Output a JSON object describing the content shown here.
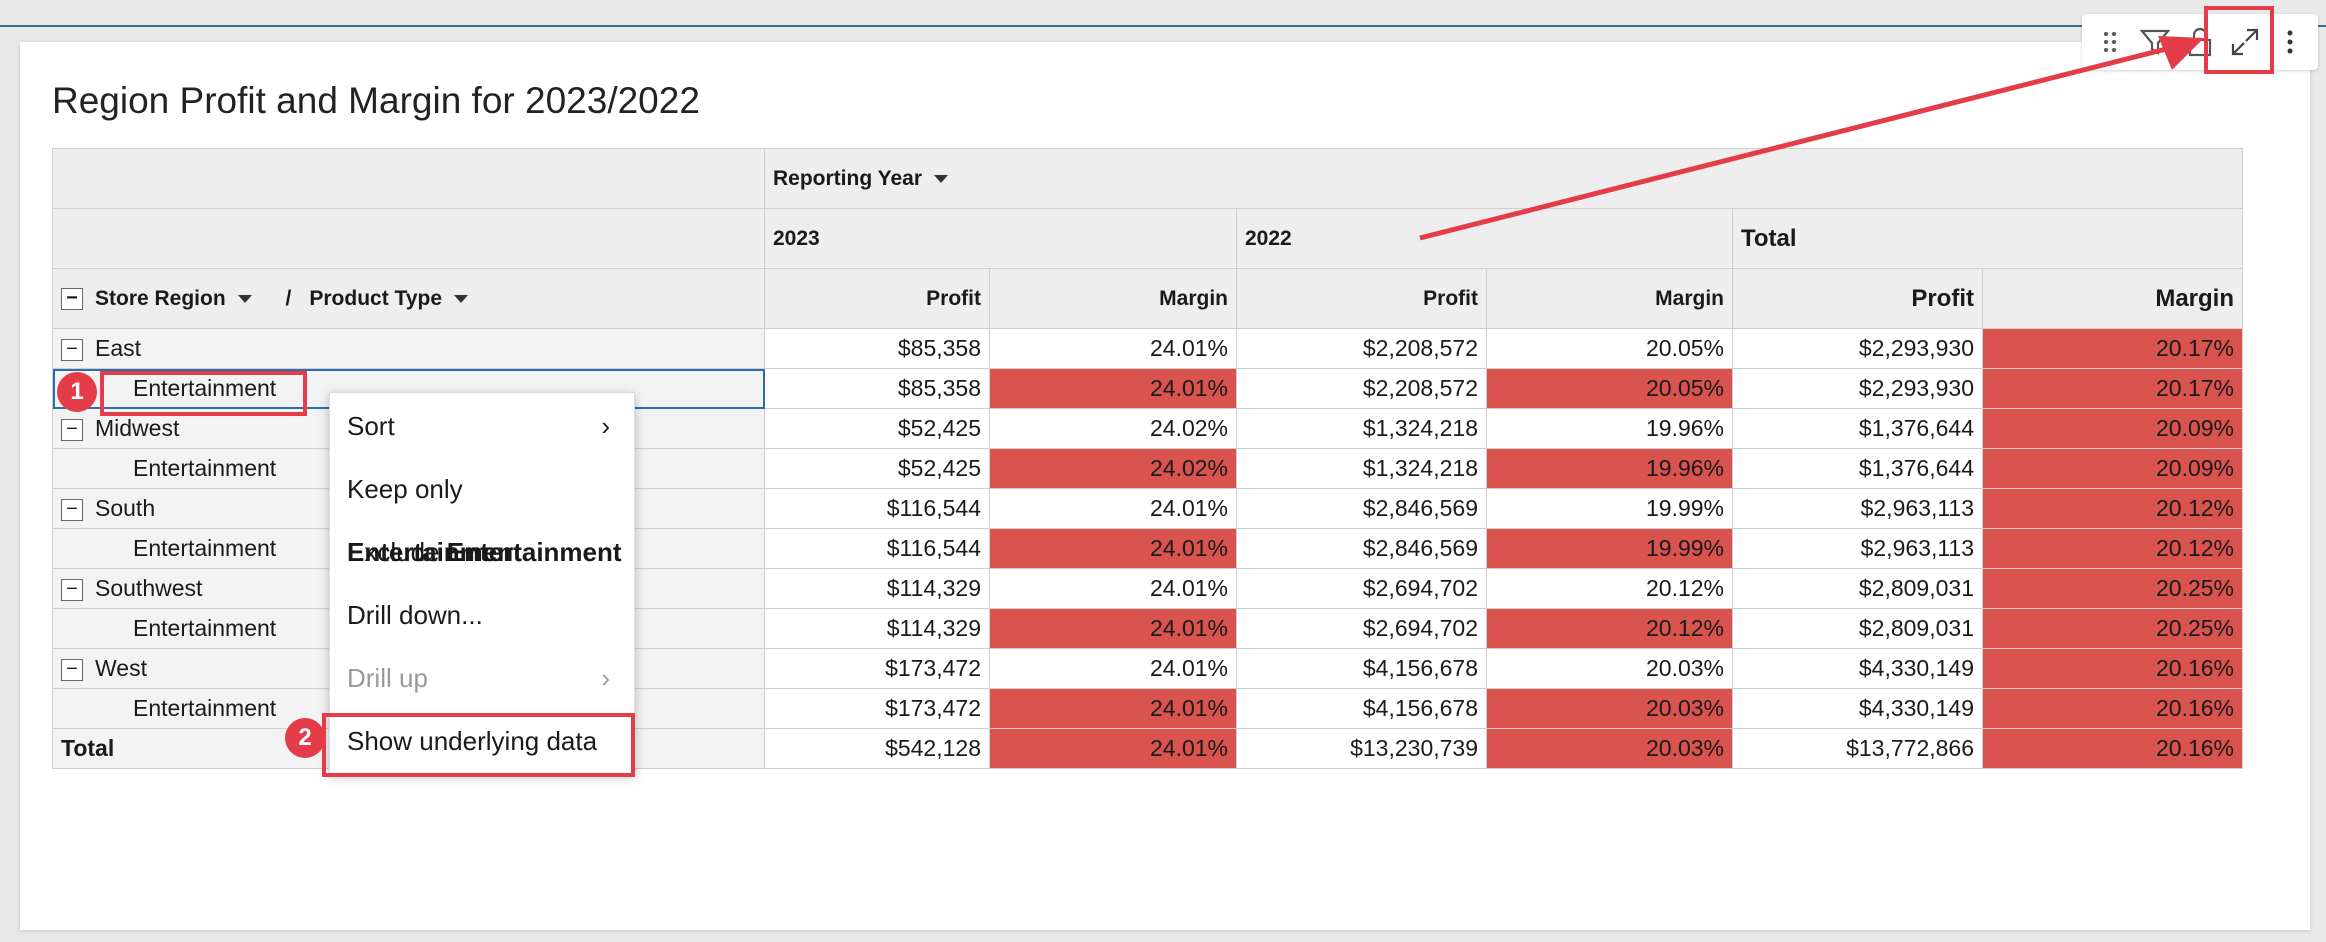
{
  "title": "Region Profit and Margin for 2023/2022",
  "colors": {
    "highlight": "#d9534f",
    "annotation_red": "#e53c49",
    "accent_line": "#3d6f86"
  },
  "toolbar": {
    "icons": [
      "drag-handle-icon",
      "filter-icon",
      "lock-icon",
      "expand-icon",
      "more-vertical-icon"
    ]
  },
  "pivot": {
    "column_field": "Reporting Year",
    "row_fields": [
      "Store Region",
      "Product Type"
    ],
    "separator": "/",
    "year_headers": [
      "2023",
      "2022",
      "Total"
    ],
    "measure_headers": [
      "Profit",
      "Margin",
      "Profit",
      "Margin",
      "Profit",
      "Margin"
    ],
    "rows": [
      {
        "label": "East",
        "level": 0,
        "values": [
          "$85,358",
          "24.01%",
          "$2,208,572",
          "20.05%",
          "$2,293,930",
          "20.17%"
        ]
      },
      {
        "label": "Entertainment",
        "level": 1,
        "values": [
          "$85,358",
          "24.01%",
          "$2,208,572",
          "20.05%",
          "$2,293,930",
          "20.17%"
        ]
      },
      {
        "label": "Midwest",
        "level": 0,
        "values": [
          "$52,425",
          "24.02%",
          "$1,324,218",
          "19.96%",
          "$1,376,644",
          "20.09%"
        ]
      },
      {
        "label": "Entertainment",
        "level": 1,
        "values": [
          "$52,425",
          "24.02%",
          "$1,324,218",
          "19.96%",
          "$1,376,644",
          "20.09%"
        ]
      },
      {
        "label": "South",
        "level": 0,
        "values": [
          "$116,544",
          "24.01%",
          "$2,846,569",
          "19.99%",
          "$2,963,113",
          "20.12%"
        ]
      },
      {
        "label": "Entertainment",
        "level": 1,
        "values": [
          "$116,544",
          "24.01%",
          "$2,846,569",
          "19.99%",
          "$2,963,113",
          "20.12%"
        ]
      },
      {
        "label": "Southwest",
        "level": 0,
        "values": [
          "$114,329",
          "24.01%",
          "$2,694,702",
          "20.12%",
          "$2,809,031",
          "20.25%"
        ]
      },
      {
        "label": "Entertainment",
        "level": 1,
        "values": [
          "$114,329",
          "24.01%",
          "$2,694,702",
          "20.12%",
          "$2,809,031",
          "20.25%"
        ]
      },
      {
        "label": "West",
        "level": 0,
        "values": [
          "$173,472",
          "24.01%",
          "$4,156,678",
          "20.03%",
          "$4,330,149",
          "20.16%"
        ]
      },
      {
        "label": "Entertainment",
        "level": 1,
        "values": [
          "$173,472",
          "24.01%",
          "$4,156,678",
          "20.03%",
          "$4,330,149",
          "20.16%"
        ]
      },
      {
        "label": "Total",
        "level": -1,
        "values": [
          "$542,128",
          "24.01%",
          "$13,230,739",
          "20.03%",
          "$13,772,866",
          "20.16%"
        ]
      }
    ]
  },
  "context_menu": {
    "items": [
      {
        "label": "Sort",
        "bold": "",
        "has_submenu": true,
        "disabled": false
      },
      {
        "label": "Keep only ",
        "bold": "Entertainment",
        "has_submenu": false,
        "disabled": false
      },
      {
        "label": "Exclude ",
        "bold": "Entertainment",
        "has_submenu": false,
        "disabled": false
      },
      {
        "label": "Drill down...",
        "bold": "",
        "has_submenu": false,
        "disabled": false
      },
      {
        "label": "Drill up",
        "bold": "",
        "has_submenu": true,
        "disabled": true
      },
      {
        "label": "Show underlying data",
        "bold": "",
        "has_submenu": false,
        "disabled": false
      }
    ]
  },
  "annotations": {
    "badge_1": "1",
    "badge_2": "2"
  }
}
